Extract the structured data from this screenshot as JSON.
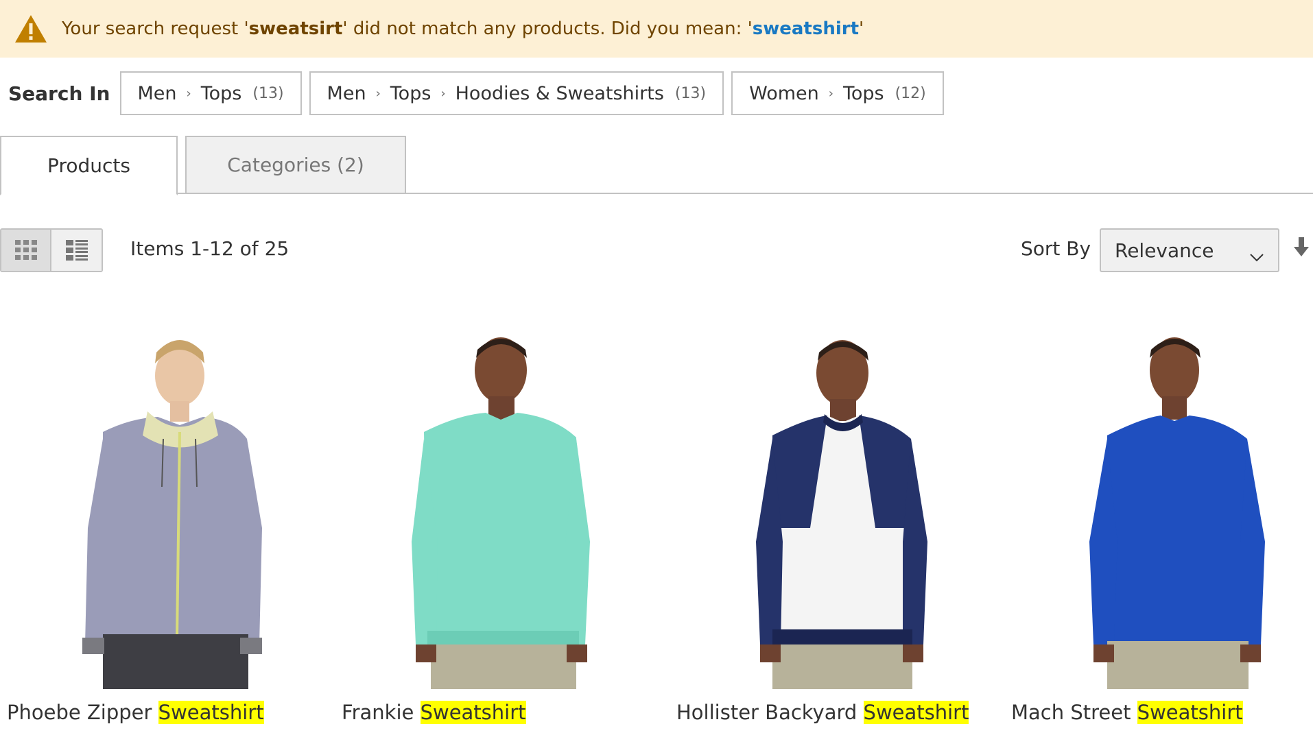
{
  "notice": {
    "prefix": "Your search request '",
    "query": "sweatsirt",
    "middle": "' did not match any products. Did you mean:  '",
    "suggestion": "sweatshirt",
    "suffix": "'",
    "icon": "warning-icon",
    "color_bg": "#fdf0d5",
    "color_text": "#6f4400"
  },
  "search_in": {
    "label": "Search In",
    "items": [
      {
        "path": [
          "Men",
          "Tops"
        ],
        "count": "(13)"
      },
      {
        "path": [
          "Men",
          "Tops",
          "Hoodies & Sweatshirts"
        ],
        "count": "(13)"
      },
      {
        "path": [
          "Women",
          "Tops"
        ],
        "count": "(12)"
      }
    ]
  },
  "tabs": [
    {
      "label": "Products",
      "active": true
    },
    {
      "label": "Categories (2)",
      "active": false
    }
  ],
  "toolbar": {
    "modes": [
      "grid-icon",
      "list-icon"
    ],
    "items_label": "Items 1-12 of 25",
    "sort_label": "Sort By",
    "sort_value": "Relevance",
    "sort_direction_icon": "arrow-down-icon"
  },
  "products": [
    {
      "name": "Phoebe Zipper ",
      "highlight": "Sweatshirt"
    },
    {
      "name": "Frankie ",
      "highlight": "Sweatshirt"
    },
    {
      "name": "Hollister Backyard ",
      "highlight": "Sweatshirt"
    },
    {
      "name": "Mach Street ",
      "highlight": "Sweatshirt"
    }
  ],
  "colors": {
    "highlight": "#ffff00",
    "link": "#1979c3"
  }
}
